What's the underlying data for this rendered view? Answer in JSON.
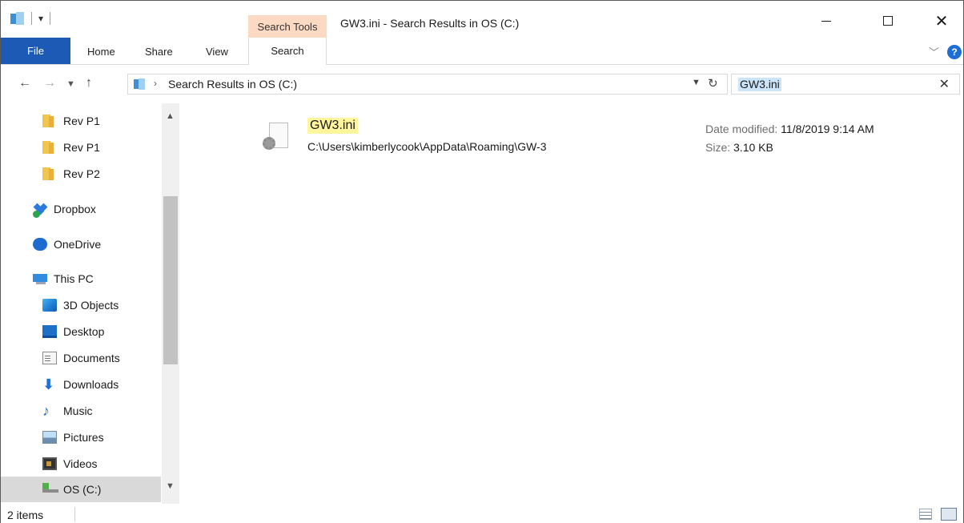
{
  "window": {
    "title": "GW3.ini - Search Results in OS (C:)",
    "context_tab_header": "Search Tools",
    "minimize": "—",
    "close": "✕"
  },
  "ribbon": {
    "tabs": [
      "File",
      "Home",
      "Share",
      "View",
      "Search"
    ],
    "help": "?"
  },
  "address": {
    "path": "Search Results in OS (C:)",
    "separator": "›"
  },
  "search": {
    "value": "GW3.ini"
  },
  "nav_pane": {
    "items": [
      {
        "label": "Rev P1",
        "icon": "folder-icon"
      },
      {
        "label": "Rev P1",
        "icon": "folder-icon"
      },
      {
        "label": "Rev P2",
        "icon": "folder-icon"
      },
      {
        "label": "Dropbox",
        "icon": "dropbox-icon"
      },
      {
        "label": "OneDrive",
        "icon": "onedrive-icon"
      },
      {
        "label": "This PC",
        "icon": "computer-icon"
      },
      {
        "label": "3D Objects",
        "icon": "3d-objects-icon"
      },
      {
        "label": "Desktop",
        "icon": "desktop-icon"
      },
      {
        "label": "Documents",
        "icon": "documents-icon"
      },
      {
        "label": "Downloads",
        "icon": "downloads-icon"
      },
      {
        "label": "Music",
        "icon": "music-icon"
      },
      {
        "label": "Pictures",
        "icon": "pictures-icon"
      },
      {
        "label": "Videos",
        "icon": "videos-icon"
      },
      {
        "label": "OS (C:)",
        "icon": "drive-icon",
        "selected": true
      }
    ]
  },
  "results": [
    {
      "name": "GW3.ini",
      "path": "C:\\Users\\kimberlycook\\AppData\\Roaming\\GW-3",
      "date_label": "Date modified:",
      "date_value": "11/8/2019 9:14 AM",
      "size_label": "Size:",
      "size_value": "3.10 KB"
    }
  ],
  "status": {
    "item_count": "2 items"
  },
  "colors": {
    "file_tab": "#1d5ab6",
    "context_tab": "#fcd9c2",
    "search_highlight": "#fff59d",
    "selection": "#d9d9d9"
  }
}
